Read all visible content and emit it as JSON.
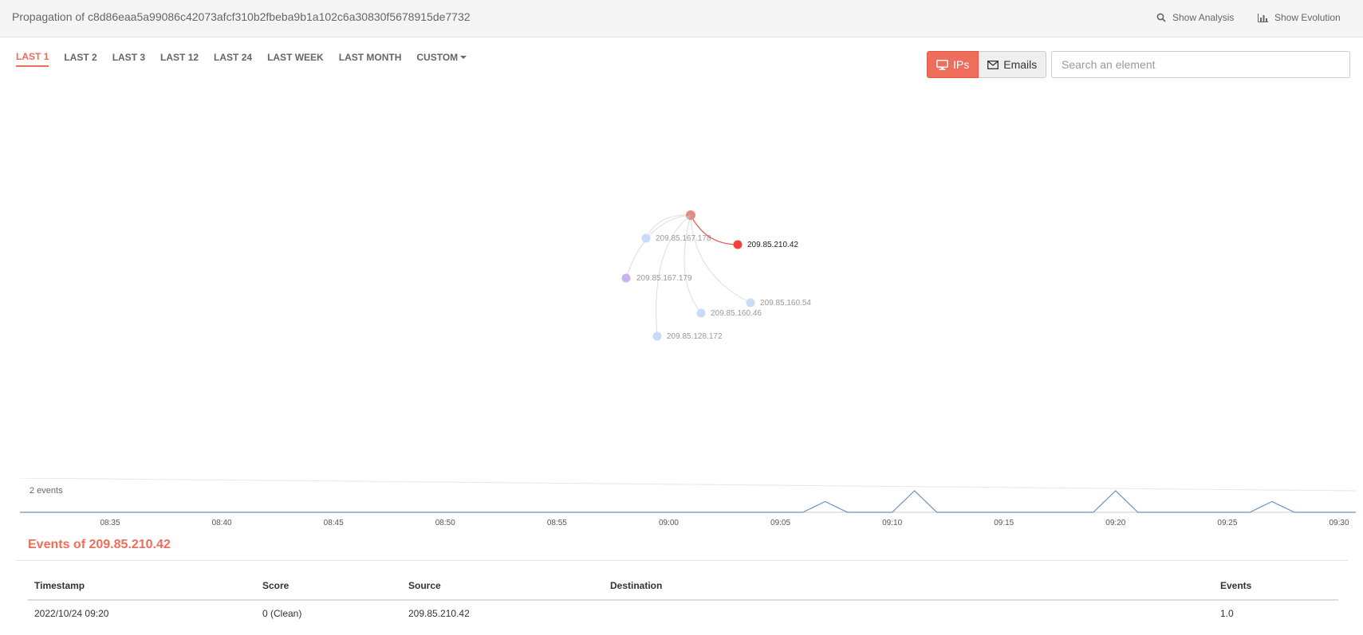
{
  "header": {
    "title": "Propagation of c8d86eaa5a99086c42073afcf310b2fbeba9b1a102c6a30830f5678915de7732",
    "show_analysis_label": "Show Analysis",
    "show_evolution_label": "Show Evolution",
    "show_analysis_icon": "search-icon",
    "show_evolution_icon": "bar-chart-icon"
  },
  "time_tabs": [
    {
      "label": "LAST 1",
      "active": true
    },
    {
      "label": "LAST 2",
      "active": false
    },
    {
      "label": "LAST 3",
      "active": false
    },
    {
      "label": "LAST 12",
      "active": false
    },
    {
      "label": "LAST 24",
      "active": false
    },
    {
      "label": "LAST WEEK",
      "active": false
    },
    {
      "label": "LAST MONTH",
      "active": false
    },
    {
      "label": "CUSTOM",
      "active": false,
      "dropdown": true
    }
  ],
  "toggle": {
    "ips_label": "IPs",
    "emails_label": "Emails",
    "ips_icon": "monitor-icon",
    "emails_icon": "envelope-icon",
    "selected": "IPs"
  },
  "search": {
    "placeholder": "Search an element",
    "value": ""
  },
  "graph": {
    "root": {
      "label": ""
    },
    "nodes": [
      {
        "label": "209.85.167.178",
        "kind": "ip"
      },
      {
        "label": "209.85.210.42",
        "kind": "selected"
      },
      {
        "label": "209.85.167.179",
        "kind": "other"
      },
      {
        "label": "209.85.160.54",
        "kind": "ip"
      },
      {
        "label": "209.85.160.46",
        "kind": "ip"
      },
      {
        "label": "209.85.128.172",
        "kind": "ip"
      }
    ],
    "colors": {
      "root": "#e88a84",
      "selected": "#f0433a",
      "ip": "#c9dcf7",
      "other": "#c9b3f0",
      "edge": "#dddddd",
      "selected_edge": "#e34b41"
    }
  },
  "timeline": {
    "y_label": "2 events",
    "x_ticks": [
      "08:35",
      "08:40",
      "08:45",
      "08:50",
      "08:55",
      "09:00",
      "09:05",
      "09:10",
      "09:15",
      "09:20",
      "09:25",
      "09:30"
    ],
    "peaks": [
      {
        "time": "09:07",
        "events": 1
      },
      {
        "time": "09:11",
        "events": 2
      },
      {
        "time": "09:20",
        "events": 2
      },
      {
        "time": "09:27",
        "events": 1
      }
    ],
    "line_color": "#6f8fc2"
  },
  "events_section": {
    "title": "Events of 209.85.210.42",
    "columns": [
      "Timestamp",
      "Score",
      "Source",
      "Destination",
      "Events"
    ],
    "rows": [
      {
        "timestamp": "2022/10/24 09:20",
        "score": "0 (Clean)",
        "source": "209.85.210.42",
        "destination": "",
        "events": "1.0"
      }
    ]
  }
}
